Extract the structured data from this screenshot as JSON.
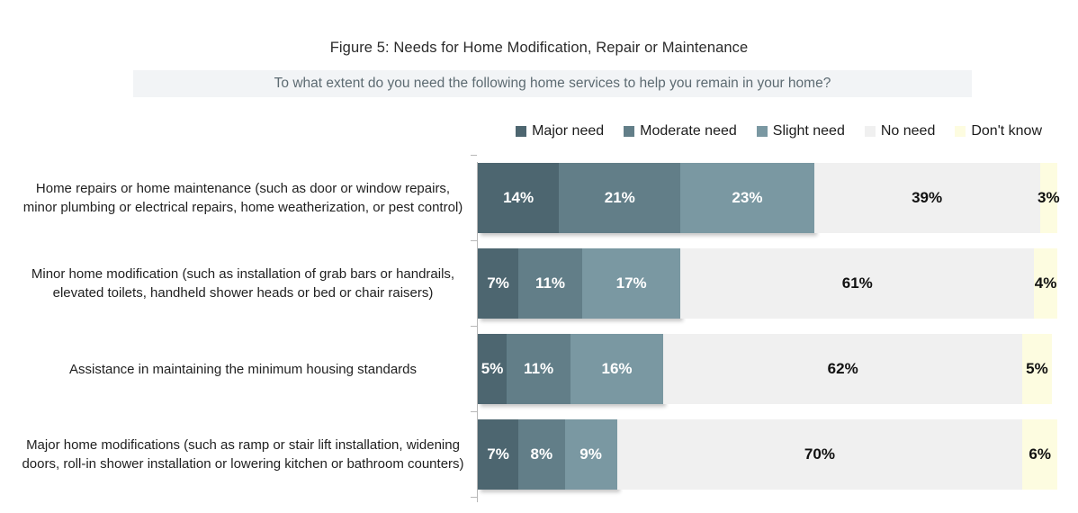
{
  "figure": {
    "title": "Figure 5: Needs for Home Modification, Repair or Maintenance",
    "subtitle": "To what extent do you need the following home services to help you remain in your home?"
  },
  "colors": {
    "major_need": "#4d6670",
    "moderate_need": "#627e88",
    "slight_need": "#7a98a2",
    "no_need": "#f0f0f0",
    "dont_know": "#fdfce0",
    "subtitle_band": "#f2f4f6",
    "subtitle_text": "#5d6b72",
    "axis": "#b8b8b8"
  },
  "chart_data": {
    "type": "bar",
    "subtype": "stacked-horizontal-100",
    "title": "Figure 5: Needs for Home Modification, Repair or Maintenance",
    "subtitle": "To what extent do you need the following home services to help you remain in your home?",
    "xlabel": "",
    "ylabel": "",
    "xlim": [
      0,
      100
    ],
    "grid": false,
    "legend_position": "top-right",
    "value_suffix": "%",
    "categories": [
      "Home repairs or home maintenance (such as door or window repairs, minor plumbing or electrical repairs, home weatherization, or pest control)",
      "Minor home modification (such as installation of grab bars or handrails, elevated toilets, handheld shower heads or bed or chair raisers)",
      "Assistance in maintaining the minimum housing standards",
      "Major home modifications (such as ramp or stair lift installation, widening doors, roll-in shower installation or lowering kitchen or bathroom counters)"
    ],
    "series": [
      {
        "name": "Major need",
        "color": "#4d6670",
        "values": [
          14,
          7,
          5,
          7
        ],
        "labels": [
          "14%",
          "7%",
          "5%",
          "7%"
        ]
      },
      {
        "name": "Moderate need",
        "color": "#627e88",
        "values": [
          21,
          11,
          11,
          8
        ],
        "labels": [
          "21%",
          "11%",
          "11%",
          "8%"
        ]
      },
      {
        "name": "Slight need",
        "color": "#7a98a2",
        "values": [
          23,
          17,
          16,
          9
        ],
        "labels": [
          "23%",
          "17%",
          "16%",
          "9%"
        ]
      },
      {
        "name": "No need",
        "color": "#f0f0f0",
        "values": [
          39,
          61,
          62,
          70
        ],
        "labels": [
          "39%",
          "61%",
          "62%",
          "70%"
        ]
      },
      {
        "name": "Don't know",
        "color": "#fdfce0",
        "values": [
          3,
          4,
          5,
          6
        ],
        "labels": [
          "3%",
          "4%",
          "5%",
          "6%"
        ]
      }
    ],
    "legend": [
      "Major need",
      "Moderate need",
      "Slight need",
      "No need",
      "Don't know"
    ]
  }
}
